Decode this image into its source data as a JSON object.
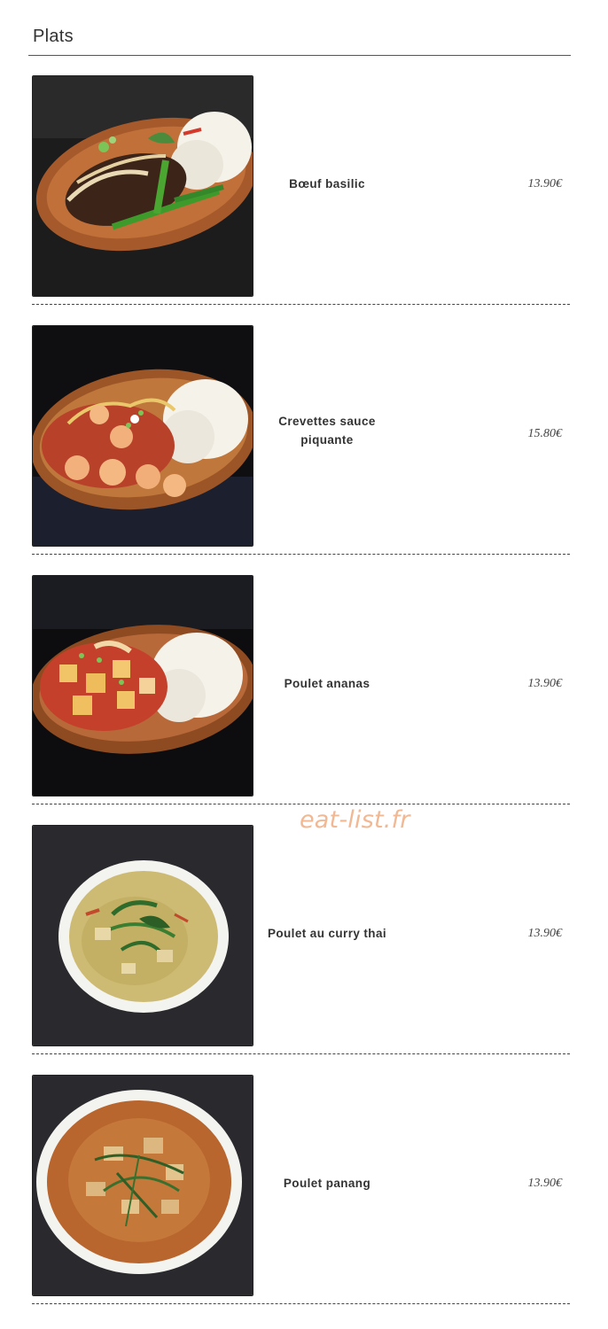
{
  "section": {
    "title": "Plats"
  },
  "items": [
    {
      "name": "Bœuf basilic",
      "price": "13.90€",
      "photo": "beef-basil-rice-plate"
    },
    {
      "name": "Crevettes sauce piquante",
      "price": "15.80€",
      "photo": "shrimp-spicy-sauce-rice-plate"
    },
    {
      "name": "Poulet ananas",
      "price": "13.90€",
      "photo": "chicken-pineapple-rice-plate"
    },
    {
      "name": "Poulet au curry thai",
      "price": "13.90€",
      "photo": "green-curry-bowl"
    },
    {
      "name": "Poulet panang",
      "price": "13.90€",
      "photo": "panang-curry-bowl"
    }
  ],
  "watermark": "eat-list.fr",
  "colors": {
    "divider": "#444444",
    "watermark": "#f1b894",
    "plate_wood": "#b8693a",
    "rice": "#f4f1ea",
    "bowl": "#f3f3ef"
  }
}
